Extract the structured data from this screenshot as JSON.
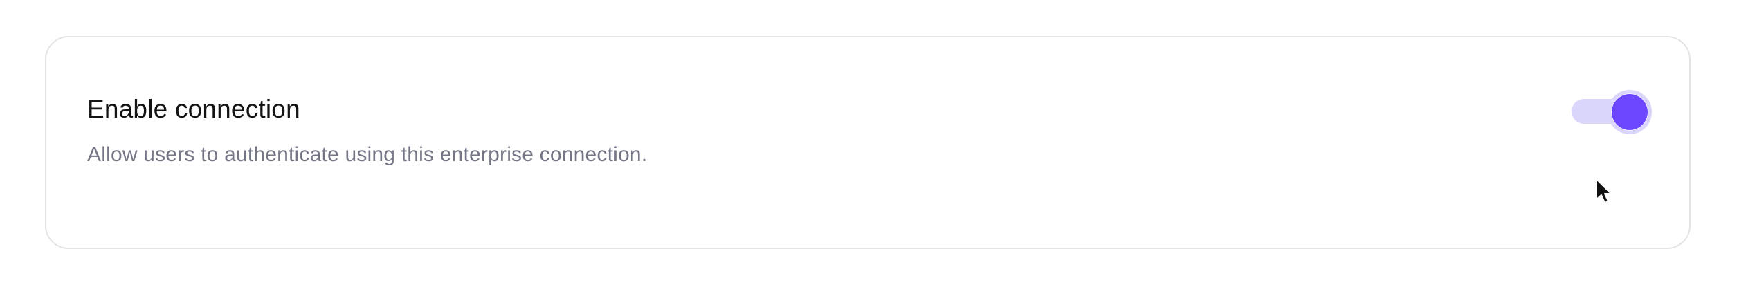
{
  "setting": {
    "title": "Enable connection",
    "description": "Allow users to authenticate using this enterprise connection.",
    "toggle": {
      "state": "on",
      "track_color": "#d9d5fb",
      "thumb_color": "#6c47ff"
    }
  },
  "icons": {
    "cursor": "mouse-pointer-icon"
  },
  "colors": {
    "title_text": "#131316",
    "description_text": "#747686",
    "card_border": "#e3e3e6"
  }
}
